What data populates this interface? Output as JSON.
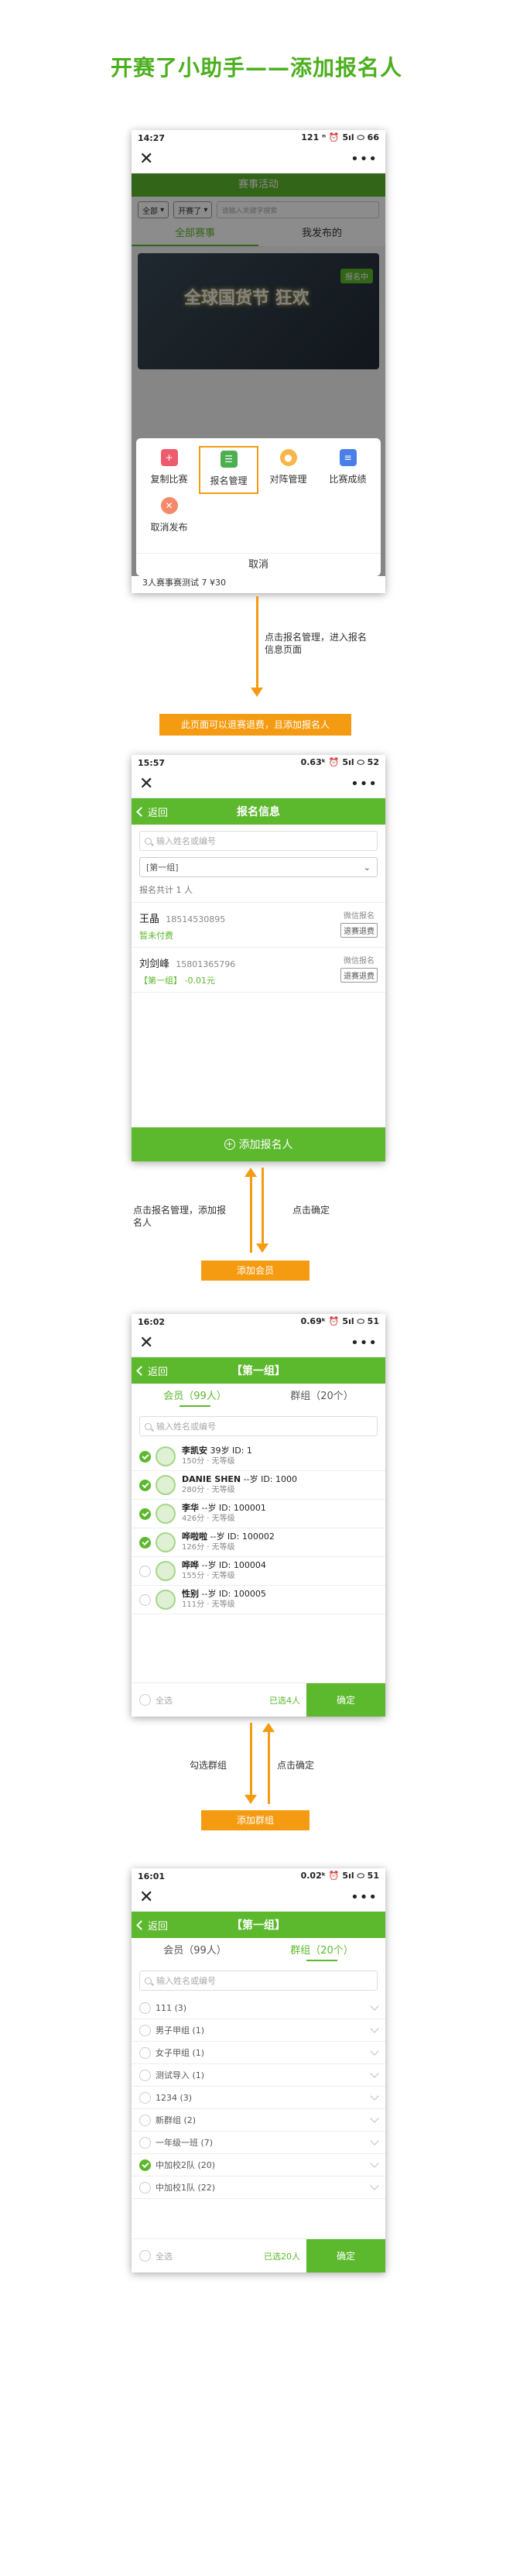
{
  "title": "开赛了小助手——添加报名人",
  "screen1": {
    "status_time": "14:27",
    "status_right": "121 ⁿ ⏰ 5ıl ⬭ 66",
    "header": "赛事活动",
    "filter_all": "全部",
    "filter_status": "开赛了",
    "search_placeholder": "请输入关键字搜索",
    "tabs": [
      "全部赛事",
      "我发布的"
    ],
    "card_text": "全球国货节 狂欢",
    "card_tag": "报名中",
    "sheet_items": [
      "复制比赛",
      "报名管理",
      "对阵管理",
      "比赛成绩"
    ],
    "cancel_publish": "取消发布",
    "cancel": "取消",
    "bg_row": "3人赛事赛测试 7 ¥30"
  },
  "note1": "点击报名管理，进入报名信息页面",
  "banner1": "此页面可以退赛退费，且添加报名人",
  "screen2": {
    "status_time": "15:57",
    "status_right": "0.63ᵏ ⏰ 5ıl ⬭ 52",
    "back": "返回",
    "title": "报名信息",
    "search_placeholder": "输入姓名或编号",
    "group": "[第一组]",
    "total": "报名共计 1 人",
    "people": [
      {
        "name": "王晶",
        "phone": "18514530895",
        "sub": "暂未付费",
        "source": "微信报名",
        "btn": "退赛退费"
      },
      {
        "name": "刘剑峰",
        "phone": "15801365796",
        "sub": "【第一组】 -0.01元",
        "source": "微信报名",
        "btn": "退赛退费"
      }
    ],
    "add_btn": "添加报名人"
  },
  "note2_left": "点击报名管理，添加报名人",
  "note2_right": "点击确定",
  "btn2": "添加会员",
  "screen3": {
    "status_time": "16:02",
    "status_right": "0.69ᵏ ⏰ 5ıl ⬭ 51",
    "back": "返回",
    "title": "【第一组】",
    "tabs": [
      "会员（99人）",
      "群组（20个）"
    ],
    "search_placeholder": "输入姓名或编号",
    "members": [
      {
        "name": "李凯安",
        "meta": "39岁  ID: 1",
        "sub1": "150分",
        "sub2": "无等级",
        "checked": true
      },
      {
        "name": "DANIE SHEN",
        "meta": "--岁  ID: 1000",
        "sub1": "280分",
        "sub2": "无等级",
        "checked": true
      },
      {
        "name": "李华",
        "meta": "--岁  ID: 100001",
        "sub1": "426分",
        "sub2": "无等级",
        "checked": true
      },
      {
        "name": "哗啦啦",
        "meta": "--岁  ID: 100002",
        "sub1": "126分",
        "sub2": "无等级",
        "checked": true
      },
      {
        "name": "哗哗",
        "meta": "--岁  ID: 100004",
        "sub1": "155分",
        "sub2": "无等级",
        "checked": false
      },
      {
        "name": "性别",
        "meta": "--岁  ID: 100005",
        "sub1": "111分",
        "sub2": "无等级",
        "checked": false
      }
    ],
    "select_all": "全选",
    "count": "已选4人",
    "confirm": "确定"
  },
  "note3_left": "勾选群组",
  "note3_right": "点击确定",
  "btn3": "添加群组",
  "screen4": {
    "status_time": "16:01",
    "status_right": "0.02ᵏ ⏰ 5ıl ⬭ 51",
    "back": "返回",
    "title": "【第一组】",
    "tabs": [
      "会员（99人）",
      "群组（20个）"
    ],
    "search_placeholder": "输入姓名或编号",
    "groups": [
      {
        "name": "111 (3)",
        "checked": false
      },
      {
        "name": "男子甲组 (1)",
        "checked": false
      },
      {
        "name": "女子甲组 (1)",
        "checked": false
      },
      {
        "name": "测试导入 (1)",
        "checked": false
      },
      {
        "name": "1234 (3)",
        "checked": false
      },
      {
        "name": "新群组 (2)",
        "checked": false
      },
      {
        "name": "一年级一班 (7)",
        "checked": false
      },
      {
        "name": "中加校2队 (20)",
        "checked": true
      },
      {
        "name": "中加校1队 (22)",
        "checked": false
      }
    ],
    "select_all": "全选",
    "count": "已选20人",
    "confirm": "确定"
  }
}
